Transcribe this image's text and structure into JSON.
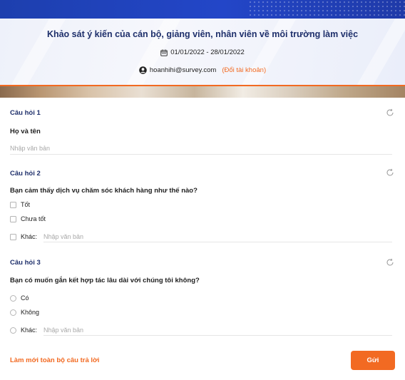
{
  "header": {
    "title": "Khảo sát ý kiến của cán bộ, giảng viên, nhân viên về môi trường làm việc",
    "date_range": "01/01/2022 - 28/01/2022",
    "email": "hoanhihi@survey.com",
    "switch_account": "(Đổi tài khoản)"
  },
  "questions": [
    {
      "label": "Câu hỏi 1",
      "text": "Họ và tên",
      "type": "text",
      "placeholder": "Nhập văn bản"
    },
    {
      "label": "Câu hỏi 2",
      "text": "Bạn cảm thấy dịch vụ chăm sóc khách hàng như thế nào?",
      "type": "checkbox",
      "options": [
        "Tốt",
        "Chưa tốt"
      ],
      "other_label": "Khác:",
      "other_placeholder": "Nhập văn bản"
    },
    {
      "label": "Câu hỏi 3",
      "text": "Bạn có muốn gắn kết hợp tác lâu dài với chúng tôi không?",
      "type": "radio",
      "options": [
        "Có",
        "Không"
      ],
      "other_label": "Khác:",
      "other_placeholder": "Nhập văn bản"
    }
  ],
  "footer": {
    "clear_label": "Làm mới toàn bộ câu trả lời",
    "submit_label": "Gửi"
  },
  "colors": {
    "accent": "#f26a22",
    "title": "#1e2f6b",
    "topbar": "#2346c8"
  },
  "icons": {
    "calendar": "calendar-icon",
    "user": "user-icon",
    "reset": "refresh-icon"
  }
}
